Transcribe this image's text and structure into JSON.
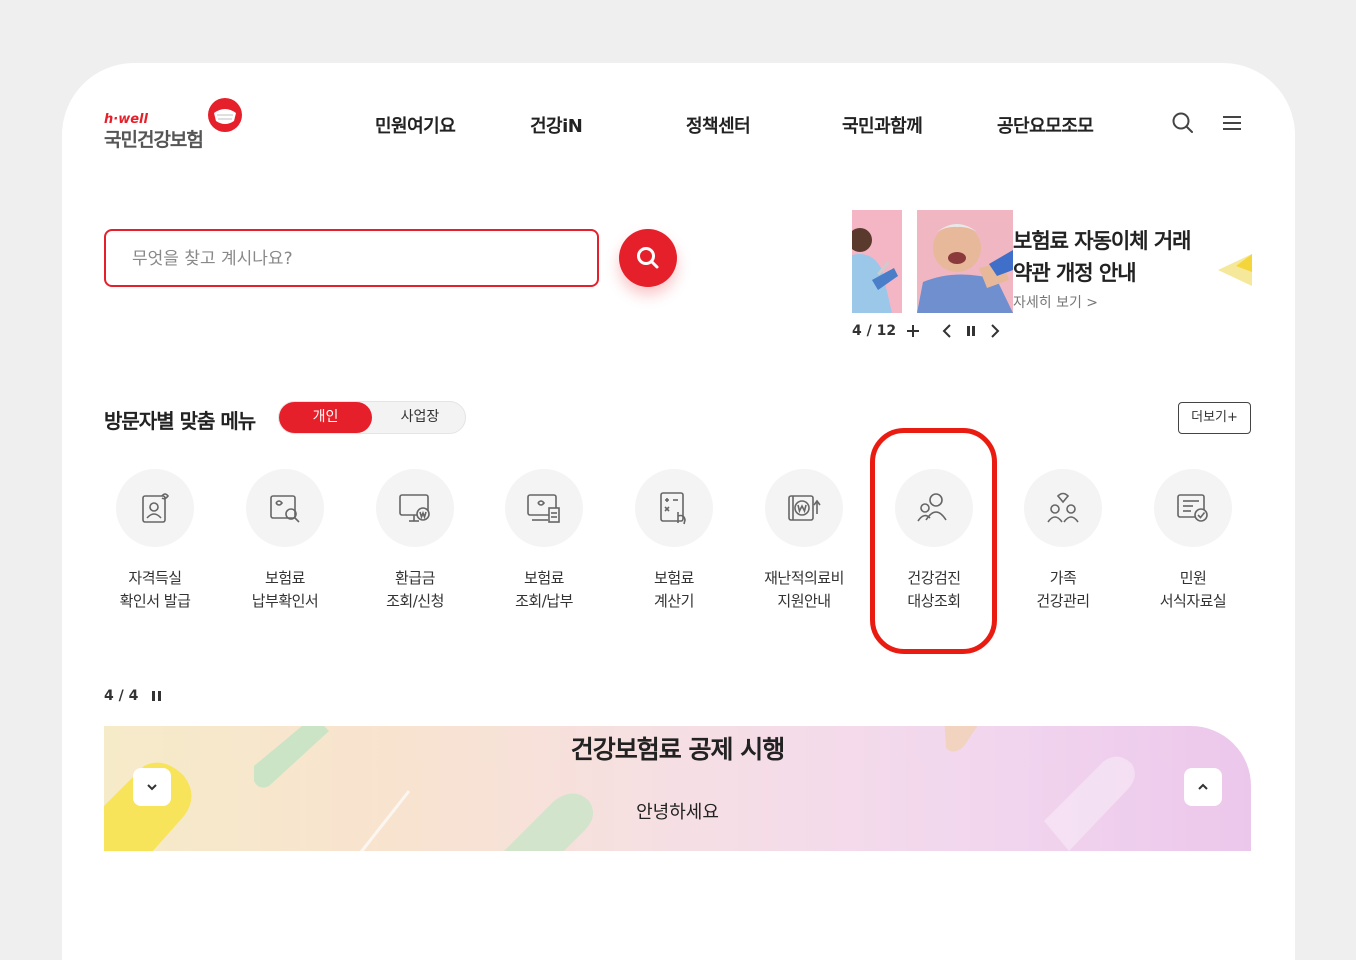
{
  "header": {
    "logo_sub": "h·well",
    "logo_main": "국민건강보험",
    "nav": [
      "민원여기요",
      "건강iN",
      "정책센터",
      "국민과함께",
      "공단요모조모"
    ]
  },
  "search": {
    "placeholder": "무엇을 찾고 계시나요?"
  },
  "banner": {
    "title_line1": "보험료 자동이체 거래",
    "title_line2": "약관 개정 안내",
    "link_label": "자세히 보기 >",
    "pager": "4 / 12"
  },
  "menu": {
    "section_title": "방문자별 맞춤 메뉴",
    "toggle_on": "개인",
    "toggle_off": "사업장",
    "more_label": "더보기+",
    "items": [
      {
        "line1": "자격득실",
        "line2": "확인서 발급"
      },
      {
        "line1": "보험료",
        "line2": "납부확인서"
      },
      {
        "line1": "환급금",
        "line2": "조회/신청"
      },
      {
        "line1": "보험료",
        "line2": "조회/납부"
      },
      {
        "line1": "보험료",
        "line2": "계산기"
      },
      {
        "line1": "재난적의료비",
        "line2": "지원안내"
      },
      {
        "line1": "건강검진",
        "line2": "대상조회"
      },
      {
        "line1": "가족",
        "line2": "건강관리"
      },
      {
        "line1": "민원",
        "line2": "서식자료실"
      }
    ]
  },
  "pager2": "4 / 4",
  "promo": {
    "title": "건강보험료 공제 시행",
    "subtitle": "안녕하세요"
  },
  "colors": {
    "brand_red": "#e6202a",
    "highlight": "#ea1c12"
  }
}
